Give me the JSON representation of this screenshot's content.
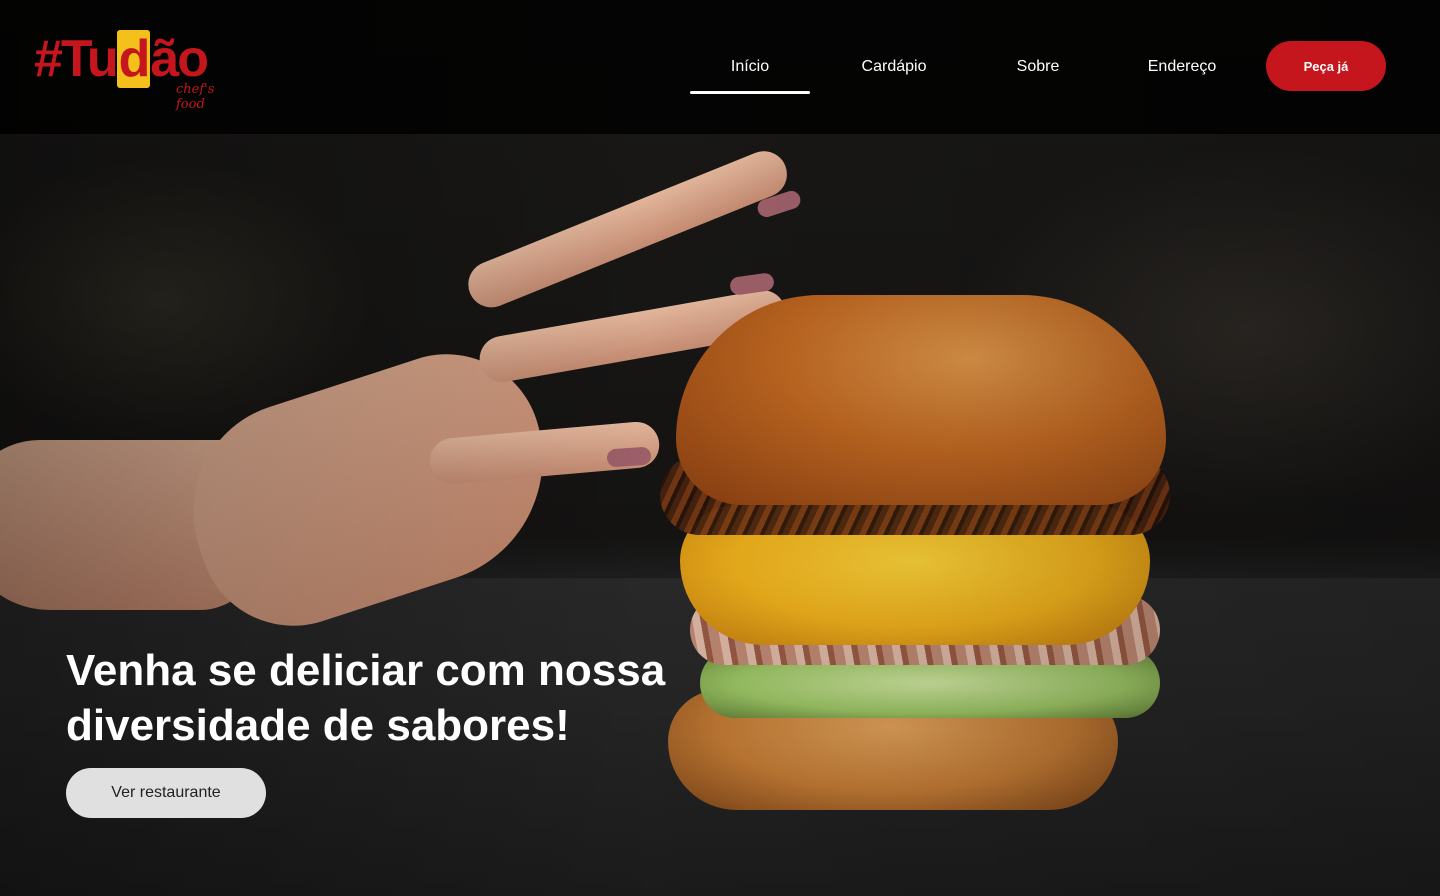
{
  "brand": {
    "logo_main": "#Tu",
    "logo_highlight": "d",
    "logo_end": "ão",
    "logo_tagline": "chef's food",
    "colors": {
      "primary": "#c4161c",
      "accent": "#f4c01b"
    }
  },
  "nav": {
    "items": [
      {
        "label": "Início",
        "active": true
      },
      {
        "label": "Cardápio",
        "active": false
      },
      {
        "label": "Sobre",
        "active": false
      },
      {
        "label": "Endereço",
        "active": false
      }
    ],
    "order_button": "Peça já"
  },
  "hero": {
    "headline": "Venha se deliciar com nossa diversidade de sabores!",
    "cta_label": "Ver restaurante",
    "image_subject": "burger-with-hand"
  }
}
